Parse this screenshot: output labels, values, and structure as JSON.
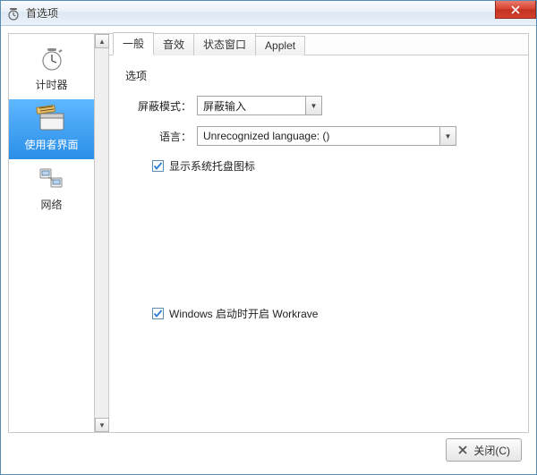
{
  "window": {
    "title": "首选项"
  },
  "sidebar": {
    "items": [
      {
        "label": "计时器"
      },
      {
        "label": "使用者界面"
      },
      {
        "label": "网络"
      }
    ]
  },
  "tabs": {
    "items": [
      {
        "label": "一般"
      },
      {
        "label": "音效"
      },
      {
        "label": "状态窗口"
      },
      {
        "label": "Applet"
      }
    ]
  },
  "panel": {
    "group_title": "选项",
    "block_mode_label": "屏蔽模式：",
    "block_mode_value": "屏蔽输入",
    "language_label": "语言：",
    "language_value": "Unrecognized language: ()",
    "tray_checkbox_label": "显示系统托盘图标",
    "autostart_checkbox_label": "Windows 启动时开启 Workrave"
  },
  "footer": {
    "close_label": "关闭(C)"
  }
}
